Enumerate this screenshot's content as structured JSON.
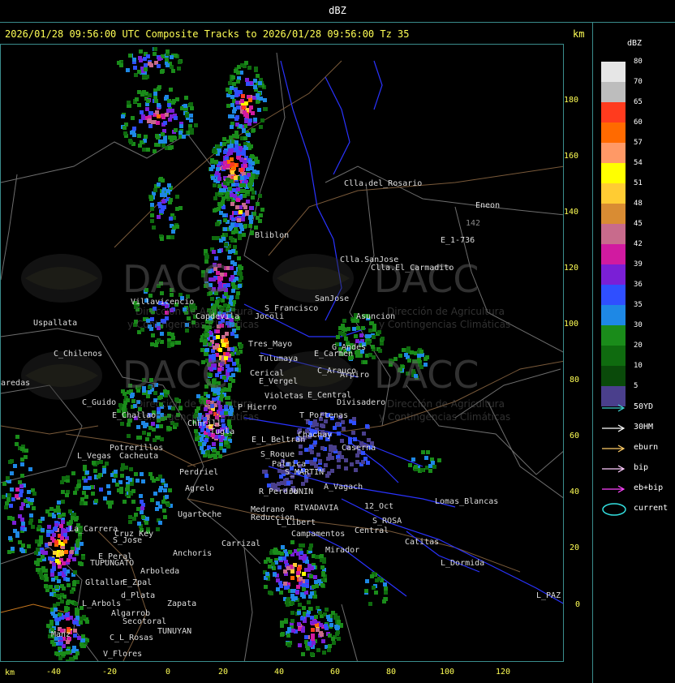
{
  "window_title": "dBZ",
  "header": {
    "text": "2026/01/28 09:56:00 UTC Composite Tracks to 2026/01/28 09:56:00 Tz 35",
    "unit": "km"
  },
  "axes": {
    "x_unit": "km",
    "x_ticks": [
      "-40",
      "-20",
      "0",
      "20",
      "40",
      "60",
      "80",
      "100",
      "120"
    ],
    "y_ticks": [
      "180",
      "160",
      "140",
      "120",
      "100",
      "80",
      "60",
      "40",
      "20",
      "0"
    ]
  },
  "legend": {
    "title": "dBZ",
    "scale": [
      {
        "value": "80",
        "color": "#e6e6e6"
      },
      {
        "value": "70",
        "color": "#bdbdbd"
      },
      {
        "value": "65",
        "color": "#ff3b1e"
      },
      {
        "value": "60",
        "color": "#ff6a00"
      },
      {
        "value": "57",
        "color": "#ff9966"
      },
      {
        "value": "54",
        "color": "#ffff00"
      },
      {
        "value": "51",
        "color": "#ffcc33"
      },
      {
        "value": "48",
        "color": "#d98c33"
      },
      {
        "value": "45",
        "color": "#c86b8c"
      },
      {
        "value": "42",
        "color": "#d11aa0"
      },
      {
        "value": "39",
        "color": "#7a1fd6"
      },
      {
        "value": "36",
        "color": "#2f4fff"
      },
      {
        "value": "35",
        "color": "#1e88e5"
      },
      {
        "value": "30",
        "color": "#1a8c1a"
      },
      {
        "value": "20",
        "color": "#0f6b0f"
      },
      {
        "value": "10",
        "color": "#0a4a0a"
      },
      {
        "value": "5",
        "color": "#4a3f8c"
      }
    ],
    "tracks": [
      {
        "label": "50YD",
        "color": "#3fd0d0"
      },
      {
        "label": "30HM",
        "color": "#ffffff"
      },
      {
        "label": "eburn",
        "color": "#ffcc66"
      },
      {
        "label": "bip",
        "color": "#ffccff"
      },
      {
        "label": "eb+bip",
        "color": "#ff44ff"
      }
    ],
    "current": {
      "label": "current",
      "color": "#33e0e0"
    }
  },
  "watermark": {
    "name": "DACC",
    "line1": "Dirección de Agricultura",
    "line2": "y Contingencias Climáticas"
  },
  "places": [
    {
      "name": "Clla.del_Rosario"
    },
    {
      "name": "Eneon"
    },
    {
      "name": "E_1-736"
    },
    {
      "name": "142"
    },
    {
      "name": "Clla.SanJose"
    },
    {
      "name": "Clla.El_Carmadito"
    },
    {
      "name": "Asuncion"
    },
    {
      "name": "SanJose"
    },
    {
      "name": "S_Francisco"
    },
    {
      "name": "Capdevila"
    },
    {
      "name": "Villavicencio"
    },
    {
      "name": "Uspallata"
    },
    {
      "name": "C_Chilenos"
    },
    {
      "name": "aredas"
    },
    {
      "name": "Tres_Mayo"
    },
    {
      "name": "Tulumaya"
    },
    {
      "name": "E_Carmen"
    },
    {
      "name": "G_Andes"
    },
    {
      "name": "C_Arauco"
    },
    {
      "name": "E_Vergel"
    },
    {
      "name": "Violetas"
    },
    {
      "name": "Arpiro"
    },
    {
      "name": "Cerical"
    },
    {
      "name": "P_Hierro"
    },
    {
      "name": "E_Central"
    },
    {
      "name": "Divisadero"
    },
    {
      "name": "T_Portenas"
    },
    {
      "name": "C_Guido"
    },
    {
      "name": "E_Challao"
    },
    {
      "name": "Chachay"
    },
    {
      "name": "E_L_Beltran"
    },
    {
      "name": "Caserna"
    },
    {
      "name": "S_Roque"
    },
    {
      "name": "Palmica"
    },
    {
      "name": "S_MARTIN"
    },
    {
      "name": "A_Vagach"
    },
    {
      "name": "Potrerillos"
    },
    {
      "name": "L_Vegas"
    },
    {
      "name": "Cacheuta"
    },
    {
      "name": "Perdriel"
    },
    {
      "name": "Agrelo"
    },
    {
      "name": "R_Perdro"
    },
    {
      "name": "JUNIN"
    },
    {
      "name": "12_Oct"
    },
    {
      "name": "Lomas_Blancas"
    },
    {
      "name": "Medrano"
    },
    {
      "name": "Reduccion"
    },
    {
      "name": "RIVADAVIA"
    },
    {
      "name": "Ugarteche"
    },
    {
      "name": "L_Libert"
    },
    {
      "name": "Campamentos"
    },
    {
      "name": "Central"
    },
    {
      "name": "S_ROSA"
    },
    {
      "name": "Catitas"
    },
    {
      "name": "La_Carrera"
    },
    {
      "name": "S_Jose"
    },
    {
      "name": "Cruz_Key"
    },
    {
      "name": "Carrizal"
    },
    {
      "name": "Anchoris"
    },
    {
      "name": "Mirador"
    },
    {
      "name": "L_Dormida"
    },
    {
      "name": "TUPUNGATO"
    },
    {
      "name": "E_Peral"
    },
    {
      "name": "Gltallar"
    },
    {
      "name": "E_Zpal"
    },
    {
      "name": "Arboleda"
    },
    {
      "name": "L_PAZ"
    },
    {
      "name": "L_Arbols"
    },
    {
      "name": "Zapata"
    },
    {
      "name": "Algarrob"
    },
    {
      "name": "d_Plata"
    },
    {
      "name": "Secotoral"
    },
    {
      "name": "TUNUYAN"
    },
    {
      "name": "Manz"
    },
    {
      "name": "C_L_Rosas"
    },
    {
      "name": "V_Flores"
    },
    {
      "name": "Chhrill"
    },
    {
      "name": "Tugla"
    },
    {
      "name": "Bliblon"
    },
    {
      "name": "Jocoli"
    }
  ]
}
